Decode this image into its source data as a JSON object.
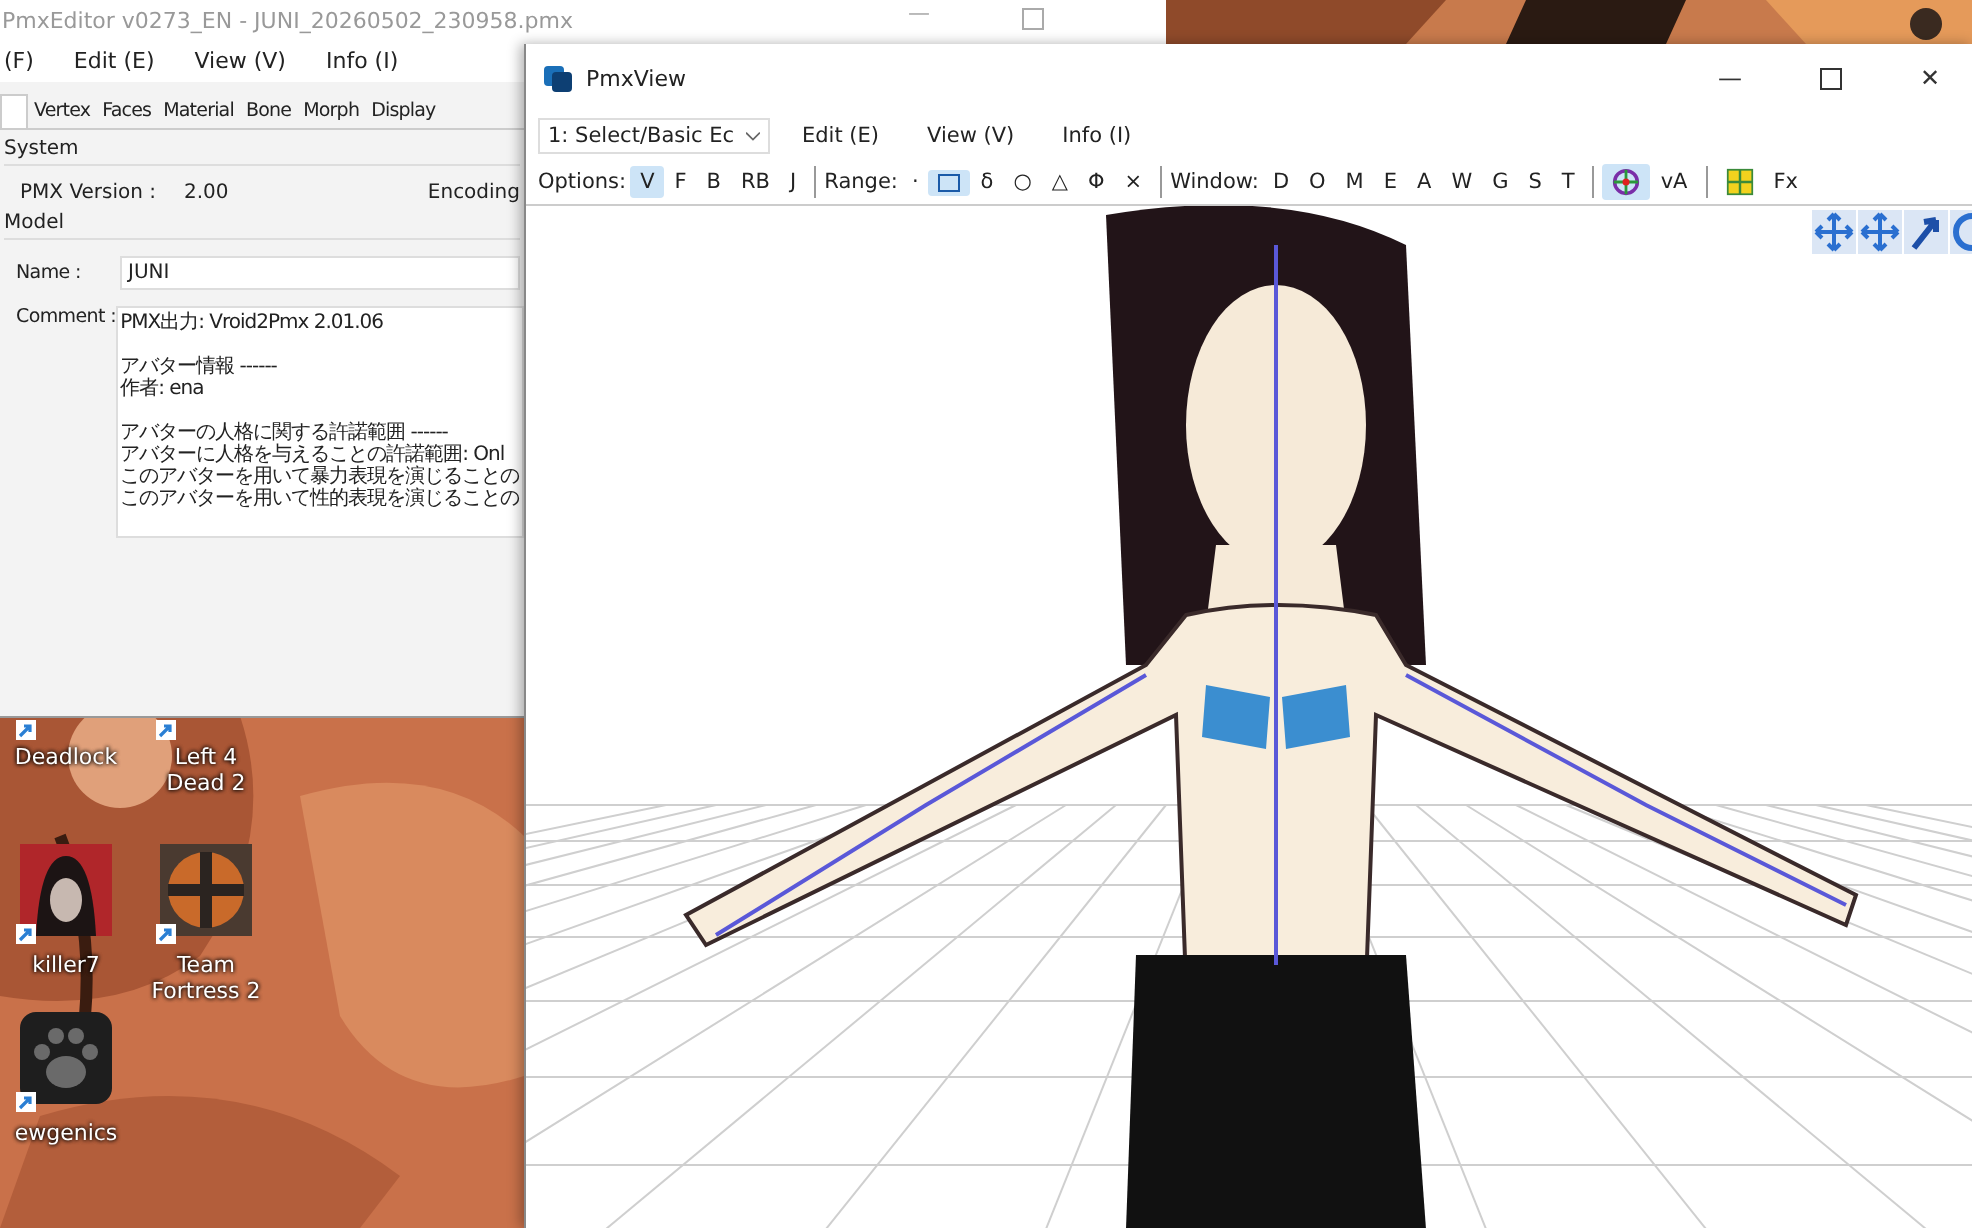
{
  "editor": {
    "title": "PmxEditor v0273_EN - JUNI_20260502_230958.pmx",
    "menu": [
      "(F)",
      "Edit (E)",
      "View (V)",
      "Info (I)"
    ],
    "window_controls": [
      "—"
    ],
    "tabs": [
      {
        "selected": true
      },
      {
        "label": "Vertex",
        "selected": false
      },
      {
        "label": "Faces",
        "selected": false
      },
      {
        "label": "Material",
        "selected": false
      },
      {
        "label": "Bone",
        "selected": false
      },
      {
        "label": "Morph",
        "selected": false
      },
      {
        "label": "Display",
        "selected": false
      }
    ],
    "system": {
      "label": "System",
      "pmx_version_label": "PMX Version :",
      "pmx_version": "2.00",
      "encoding_label": "Encoding"
    },
    "model": {
      "label": "Model",
      "name_label": "Name :",
      "name": "JUNI",
      "comment_label": "Comment :",
      "comment_paragraphs": [
        [
          "PMX出力: Vroid2Pmx 2.01.06"
        ],
        [
          "アバター情報 ------",
          "作者: ena"
        ],
        [
          "アバターの人格に関する許諾範囲 ------",
          "アバターに人格を与えることの許諾範囲: Onl",
          "このアバターを用いて暴力表現を演じることの",
          "このアバターを用いて性的表現を演じることの"
        ]
      ]
    }
  },
  "desktop_icons": [
    {
      "label": "Deadlock",
      "kind": "hidden"
    },
    {
      "label": "Left 4 Dead 2",
      "kind": "hidden"
    },
    {
      "label": "killer7",
      "kind": "portrait"
    },
    {
      "label": "Team Fortress 2",
      "kind": "emblem"
    },
    {
      "label": "ewgenics",
      "kind": "paw"
    }
  ],
  "viewer": {
    "title": "PmxView",
    "window_controls": [
      "—",
      "✕"
    ],
    "mode": "1: Select/Basic Ec",
    "menu": [
      "Edit (E)",
      "View (V)",
      "Info (I)"
    ],
    "options_label": "Options:",
    "options": [
      {
        "label": "V",
        "selected": true
      },
      {
        "label": "F",
        "selected": false
      },
      {
        "label": "B",
        "selected": false
      },
      {
        "label": "RB",
        "selected": false
      },
      {
        "label": "J",
        "selected": false
      }
    ],
    "range_label": "Range:",
    "range": [
      {
        "label": "·",
        "kind": "text",
        "selected": false
      },
      {
        "kind": "rect",
        "selected": true
      },
      {
        "label": "δ",
        "kind": "text",
        "selected": false
      },
      {
        "label": "○",
        "kind": "text",
        "selected": false
      },
      {
        "label": "△",
        "kind": "text",
        "selected": false
      },
      {
        "label": "Φ",
        "kind": "text",
        "selected": false
      },
      {
        "label": "×",
        "kind": "text",
        "selected": false
      }
    ],
    "window_label": "Window:",
    "window_buttons": [
      "D",
      "O",
      "M",
      "E",
      "A",
      "W",
      "G",
      "S",
      "T"
    ],
    "view_tools": [
      {
        "kind": "target",
        "selected": true
      },
      {
        "kind": "text",
        "label": "vA",
        "selected": false
      }
    ],
    "effect_tools": [
      {
        "kind": "grid",
        "selected": false
      },
      {
        "kind": "text",
        "label": "Fx",
        "selected": false
      }
    ]
  }
}
